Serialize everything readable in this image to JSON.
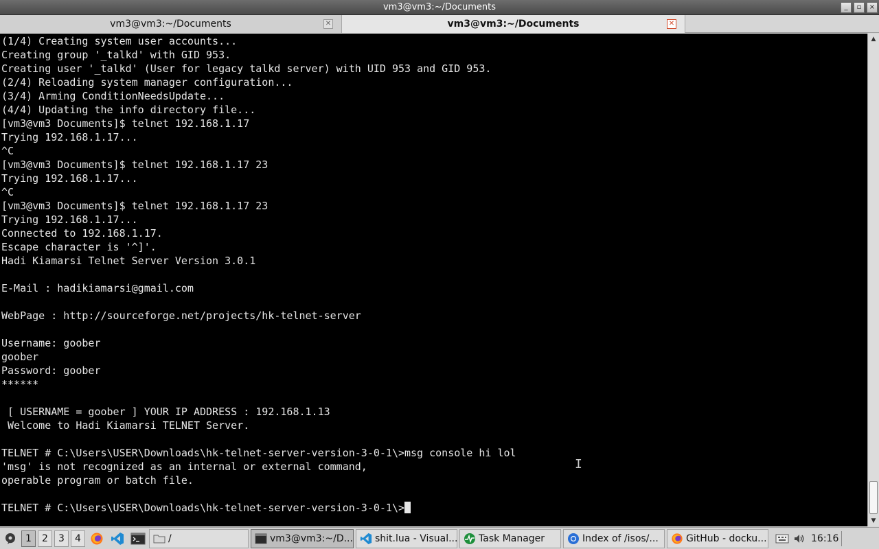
{
  "window": {
    "title": "vm3@vm3:~/Documents",
    "controls": [
      "_",
      "▫",
      "×"
    ]
  },
  "tabs": [
    {
      "label": "vm3@vm3:~/Documents",
      "active": false
    },
    {
      "label": "vm3@vm3:~/Documents",
      "active": true
    }
  ],
  "terminal": {
    "lines": [
      "(1/4) Creating system user accounts...",
      "Creating group '_talkd' with GID 953.",
      "Creating user '_talkd' (User for legacy talkd server) with UID 953 and GID 953.",
      "(2/4) Reloading system manager configuration...",
      "(3/4) Arming ConditionNeedsUpdate...",
      "(4/4) Updating the info directory file...",
      "[vm3@vm3 Documents]$ telnet 192.168.1.17",
      "Trying 192.168.1.17...",
      "^C",
      "[vm3@vm3 Documents]$ telnet 192.168.1.17 23",
      "Trying 192.168.1.17...",
      "^C",
      "[vm3@vm3 Documents]$ telnet 192.168.1.17 23",
      "Trying 192.168.1.17...",
      "Connected to 192.168.1.17.",
      "Escape character is '^]'.",
      "Hadi Kiamarsi Telnet Server Version 3.0.1",
      "",
      "E-Mail : hadikiamarsi@gmail.com",
      "",
      "WebPage : http://sourceforge.net/projects/hk-telnet-server",
      "",
      "Username: goober",
      "goober",
      "Password: goober",
      "******",
      "",
      " [ USERNAME = goober ] YOUR IP ADDRESS : 192.168.1.13",
      " Welcome to Hadi Kiamarsi TELNET Server.",
      "",
      "TELNET # C:\\Users\\USER\\Downloads\\hk-telnet-server-version-3-0-1\\>msg console hi lol",
      "'msg' is not recognized as an internal or external command,",
      "operable program or batch file.",
      "",
      "TELNET # C:\\Users\\USER\\Downloads\\hk-telnet-server-version-3-0-1\\>"
    ],
    "colors": {
      "background": "#000000",
      "foreground": "#e6e6e6"
    }
  },
  "taskbar": {
    "workspaces": [
      "1",
      "2",
      "3",
      "4"
    ],
    "active_workspace": "1",
    "launchers": [
      "firefox-icon",
      "vscode-icon",
      "terminal-icon"
    ],
    "tasks": [
      {
        "label": "/",
        "icon": "folder-icon",
        "active": false
      },
      {
        "label": "vm3@vm3:~/D...",
        "icon": "terminal-icon",
        "active": true
      },
      {
        "label": "shit.lua - Visual...",
        "icon": "vscode-icon",
        "active": false
      },
      {
        "label": "Task Manager",
        "icon": "task-manager-icon",
        "active": false
      },
      {
        "label": "Index of /isos/...",
        "icon": "chromium-icon",
        "active": false
      },
      {
        "label": "GitHub - docku...",
        "icon": "firefox-icon",
        "active": false
      }
    ],
    "tray": [
      "keyboard-icon",
      "volume-icon"
    ],
    "clock": "16:16"
  }
}
